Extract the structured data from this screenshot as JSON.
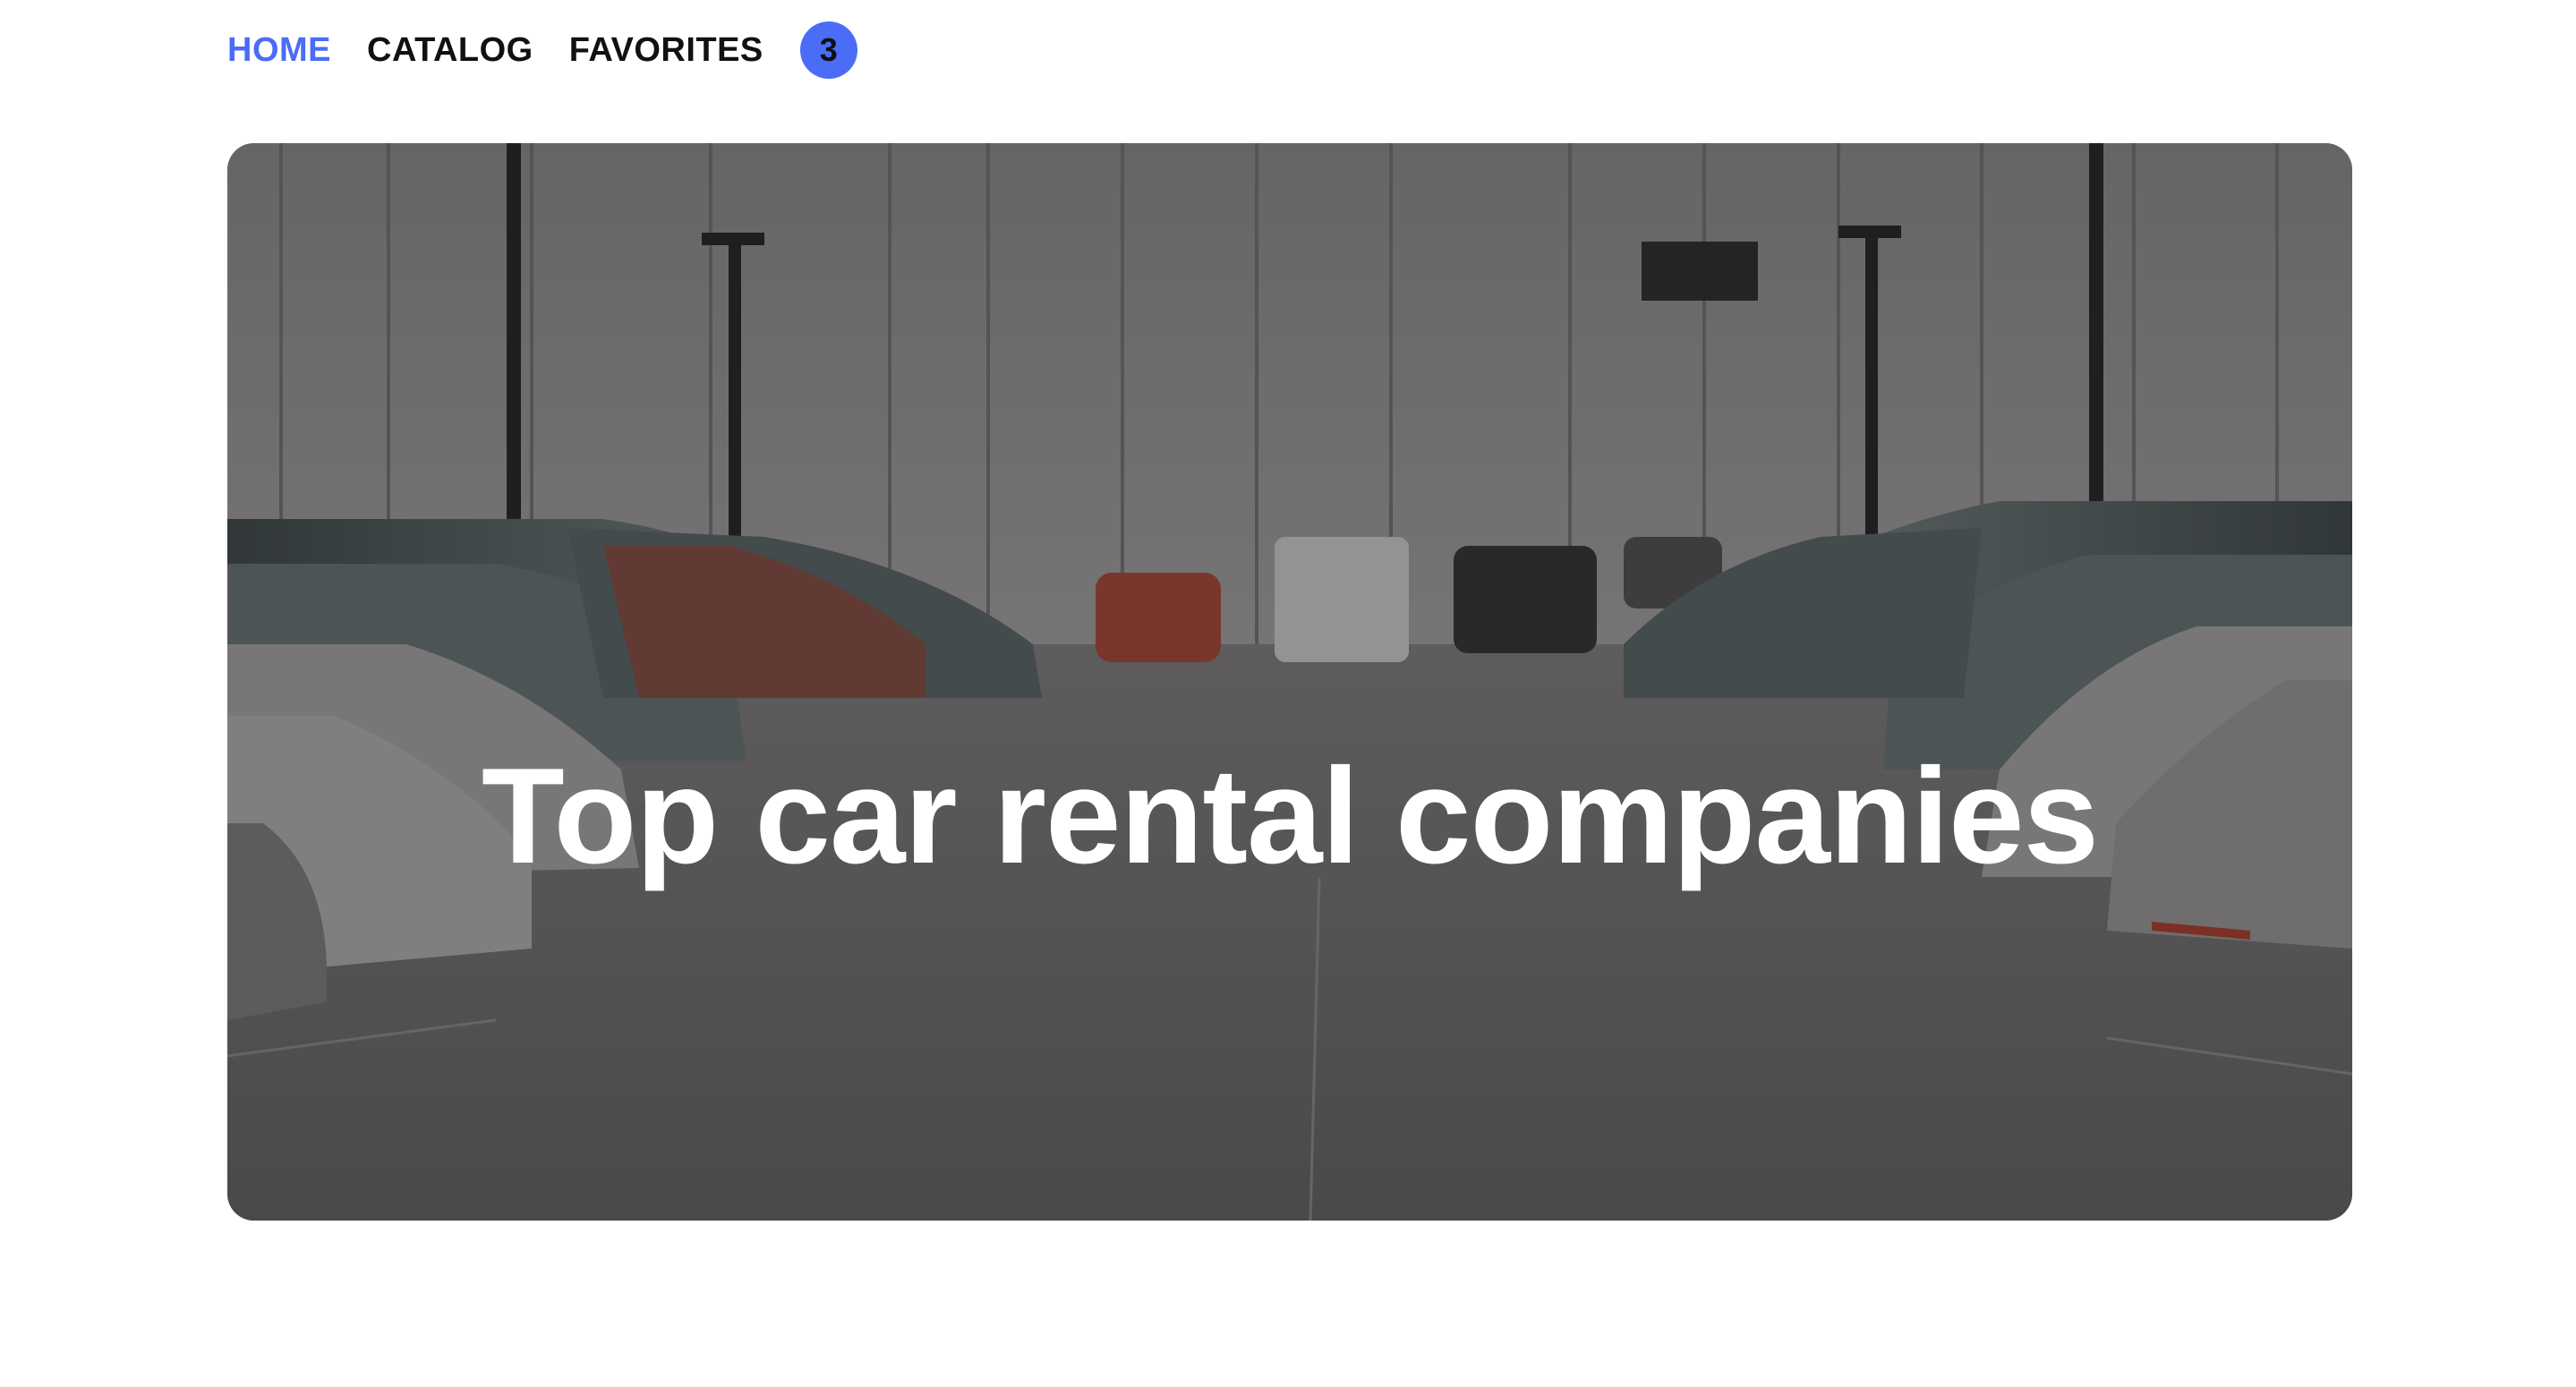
{
  "nav": {
    "items": [
      {
        "label": "HOME",
        "active": true
      },
      {
        "label": "CATALOG",
        "active": false
      },
      {
        "label": "FAVORITES",
        "active": false
      }
    ],
    "favorites_count": "3"
  },
  "hero": {
    "title": "Top car rental companies",
    "image_description": "parking-lot-with-rows-of-cars"
  },
  "colors": {
    "accent": "#4a6cf7",
    "text": "#111111",
    "hero_text": "#ffffff"
  }
}
